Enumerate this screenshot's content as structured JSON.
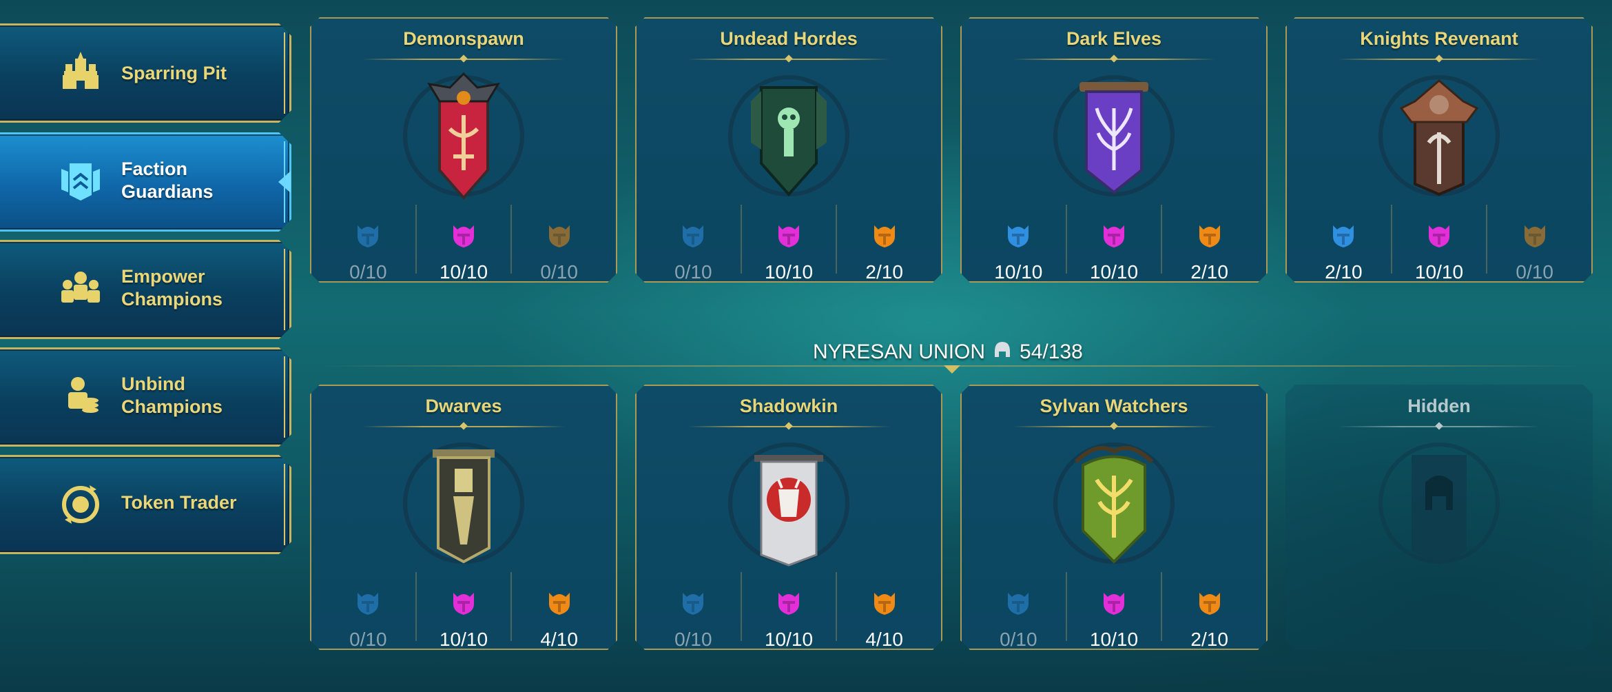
{
  "sidebar": {
    "items": [
      {
        "label": "Sparring Pit",
        "icon": "castle-icon",
        "active": false
      },
      {
        "label": "Faction\nGuardians",
        "icon": "guardian-banner-icon",
        "active": true
      },
      {
        "label": "Empower\nChampions",
        "icon": "empower-icon",
        "active": false
      },
      {
        "label": "Unbind\nChampions",
        "icon": "unbind-icon",
        "active": false
      },
      {
        "label": "Token Trader",
        "icon": "token-icon",
        "active": false
      }
    ]
  },
  "union": {
    "label": "NYRESAN UNION",
    "icon": "helmet-icon",
    "progress": "54/138"
  },
  "colors": {
    "rare": "#2f8fe0",
    "epic": "#e22fd8",
    "legendary": "#f08a16"
  },
  "factions": [
    {
      "name": "Demonspawn",
      "banner": "demonspawn-banner-icon",
      "rare": "0/10",
      "epic": "10/10",
      "legendary": "0/10"
    },
    {
      "name": "Undead Hordes",
      "banner": "undead-hordes-banner-icon",
      "rare": "0/10",
      "epic": "10/10",
      "legendary": "2/10"
    },
    {
      "name": "Dark Elves",
      "banner": "dark-elves-banner-icon",
      "rare": "10/10",
      "epic": "10/10",
      "legendary": "2/10"
    },
    {
      "name": "Knights Revenant",
      "banner": "knights-revenant-banner-icon",
      "rare": "2/10",
      "epic": "10/10",
      "legendary": "0/10"
    },
    {
      "name": "Dwarves",
      "banner": "dwarves-banner-icon",
      "rare": "0/10",
      "epic": "10/10",
      "legendary": "4/10"
    },
    {
      "name": "Shadowkin",
      "banner": "shadowkin-banner-icon",
      "rare": "0/10",
      "epic": "10/10",
      "legendary": "4/10"
    },
    {
      "name": "Sylvan Watchers",
      "banner": "sylvan-watchers-banner-icon",
      "rare": "0/10",
      "epic": "10/10",
      "legendary": "2/10"
    },
    {
      "name": "Hidden",
      "banner": "hidden-banner-icon"
    }
  ]
}
